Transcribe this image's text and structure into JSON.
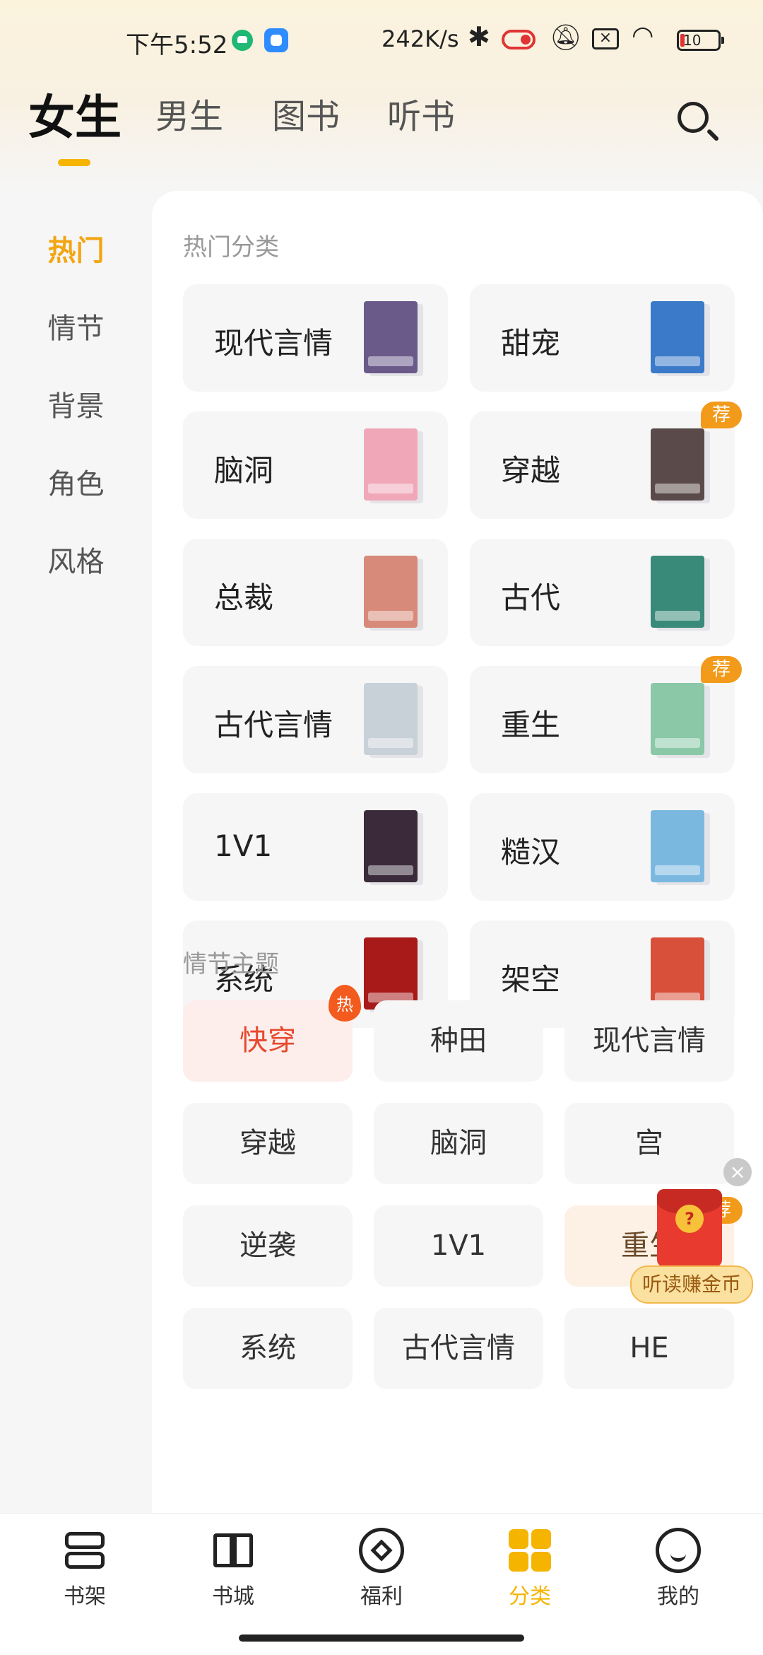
{
  "status_bar": {
    "time": "下午5:52",
    "net_speed": "242K/s",
    "battery": "10"
  },
  "top_tabs": [
    {
      "label": "女生",
      "active": true
    },
    {
      "label": "男生",
      "active": false
    },
    {
      "label": "图书",
      "active": false
    },
    {
      "label": "听书",
      "active": false
    }
  ],
  "accent_color": "#f5b400",
  "left_nav": [
    {
      "label": "热门",
      "active": true
    },
    {
      "label": "情节",
      "active": false
    },
    {
      "label": "背景",
      "active": false
    },
    {
      "label": "角色",
      "active": false
    },
    {
      "label": "风格",
      "active": false
    }
  ],
  "hot_section": {
    "title": "热门分类",
    "items": [
      {
        "label": "现代言情",
        "badge": "",
        "cover_color": "#6a5a8a"
      },
      {
        "label": "甜宠",
        "badge": "",
        "cover_color": "#3a7ac8"
      },
      {
        "label": "脑洞",
        "badge": "",
        "cover_color": "#f0a8b8"
      },
      {
        "label": "穿越",
        "badge": "荐",
        "cover_color": "#5a4a4a"
      },
      {
        "label": "总裁",
        "badge": "",
        "cover_color": "#d88a7a"
      },
      {
        "label": "古代",
        "badge": "",
        "cover_color": "#3a8a7a"
      },
      {
        "label": "古代言情",
        "badge": "",
        "cover_color": "#c8d0d8"
      },
      {
        "label": "重生",
        "badge": "荐",
        "cover_color": "#8ac8a8"
      },
      {
        "label": "1V1",
        "badge": "",
        "cover_color": "#3a2a3a"
      },
      {
        "label": "糙汉",
        "badge": "",
        "cover_color": "#7ab8e0"
      },
      {
        "label": "系统",
        "badge": "",
        "cover_color": "#a81a1a"
      },
      {
        "label": "架空",
        "badge": "",
        "cover_color": "#d8503a"
      }
    ]
  },
  "plot_section": {
    "title": "情节主题",
    "tags": [
      {
        "label": "快穿",
        "style": "hot",
        "badge": "热"
      },
      {
        "label": "种田",
        "style": "normal",
        "badge": ""
      },
      {
        "label": "现代言情",
        "style": "normal",
        "badge": ""
      },
      {
        "label": "穿越",
        "style": "normal",
        "badge": ""
      },
      {
        "label": "脑洞",
        "style": "normal",
        "badge": ""
      },
      {
        "label": "宫",
        "style": "normal",
        "badge": ""
      },
      {
        "label": "逆袭",
        "style": "normal",
        "badge": ""
      },
      {
        "label": "1V1",
        "style": "normal",
        "badge": ""
      },
      {
        "label": "重生",
        "style": "rec",
        "badge": "荐"
      },
      {
        "label": "系统",
        "style": "normal",
        "badge": ""
      },
      {
        "label": "古代言情",
        "style": "normal",
        "badge": ""
      },
      {
        "label": "HE",
        "style": "normal",
        "badge": ""
      }
    ]
  },
  "floating_promo": {
    "close_icon": "×",
    "label": "听读赚金币"
  },
  "bottom_nav": [
    {
      "label": "书架",
      "icon": "bookshelf-icon",
      "active": false
    },
    {
      "label": "书城",
      "icon": "book-icon",
      "active": false
    },
    {
      "label": "福利",
      "icon": "welfare-icon",
      "active": false
    },
    {
      "label": "分类",
      "icon": "category-icon",
      "active": true
    },
    {
      "label": "我的",
      "icon": "profile-icon",
      "active": false
    }
  ]
}
